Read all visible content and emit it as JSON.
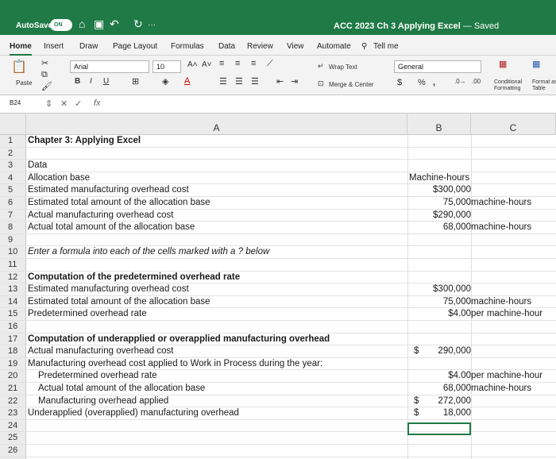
{
  "titlebar": {
    "autosave": "AutoSave",
    "toggle": "ON",
    "more": "···",
    "doc_title": "ACC 2023 Ch 3 Applying Excel",
    "saved": " — Saved"
  },
  "menu": [
    "Home",
    "Insert",
    "Draw",
    "Page Layout",
    "Formulas",
    "Data",
    "Review",
    "View",
    "Automate",
    "Tell me"
  ],
  "ribbon": {
    "paste": "Paste",
    "font_name": "Arial",
    "font_size": "10",
    "wrap_text": "Wrap Text",
    "merge_center": "Merge & Center",
    "number_format": "General",
    "conditional": "Conditional Formatting",
    "format_table": "Format as Table"
  },
  "formulabar": {
    "namebox": "B24",
    "fx": "fx"
  },
  "columns": [
    "A",
    "B",
    "C"
  ],
  "rows": [
    {
      "n": "1",
      "a": "Chapter 3: Applying Excel",
      "style": "bold"
    },
    {
      "n": "2",
      "a": ""
    },
    {
      "n": "3",
      "a": "Data"
    },
    {
      "n": "4",
      "a": "Allocation base",
      "b": "Machine-hours",
      "b_align": "left"
    },
    {
      "n": "5",
      "a": "Estimated manufacturing overhead cost",
      "b": "$300,000"
    },
    {
      "n": "6",
      "a": "Estimated total amount of the allocation base",
      "b": "75,000",
      "c": "machine-hours"
    },
    {
      "n": "7",
      "a": "Actual manufacturing overhead cost",
      "b": "$290,000"
    },
    {
      "n": "8",
      "a": "Actual total amount of the allocation base",
      "b": "68,000",
      "c": "machine-hours"
    },
    {
      "n": "9",
      "a": ""
    },
    {
      "n": "10",
      "a": "Enter a formula into each of the cells marked with a ? below",
      "style": "ital"
    },
    {
      "n": "11",
      "a": ""
    },
    {
      "n": "12",
      "a": "Computation of the predetermined overhead rate",
      "style": "bold"
    },
    {
      "n": "13",
      "a": "Estimated manufacturing overhead cost",
      "b": "$300,000"
    },
    {
      "n": "14",
      "a": "Estimated total amount of the allocation base",
      "b": "75,000",
      "c": "machine-hours"
    },
    {
      "n": "15",
      "a": "Predetermined overhead rate",
      "b": "$4.00",
      "c": "per machine-hour"
    },
    {
      "n": "16",
      "a": ""
    },
    {
      "n": "17",
      "a": "Computation of underapplied or overapplied manufacturing overhead",
      "style": "bold"
    },
    {
      "n": "18",
      "a": "Actual manufacturing overhead cost",
      "dollar": "$",
      "b": "290,000"
    },
    {
      "n": "19",
      "a": "Manufacturing overhead cost applied to Work in Process during the year:"
    },
    {
      "n": "20",
      "a": "Predetermined overhead rate",
      "indent": true,
      "b": "$4.00",
      "c": "per machine-hour"
    },
    {
      "n": "21",
      "a": "Actual total amount of the allocation base",
      "indent": true,
      "b": "68,000",
      "c": "machine-hours"
    },
    {
      "n": "22",
      "a": "Manufacturing overhead applied",
      "indent": true,
      "dollar": "$",
      "b": "272,000"
    },
    {
      "n": "23",
      "a": "Underapplied (overapplied) manufacturing overhead",
      "dollar": "$",
      "b": "18,000"
    },
    {
      "n": "24",
      "a": ""
    },
    {
      "n": "25",
      "a": ""
    },
    {
      "n": "26",
      "a": ""
    }
  ]
}
